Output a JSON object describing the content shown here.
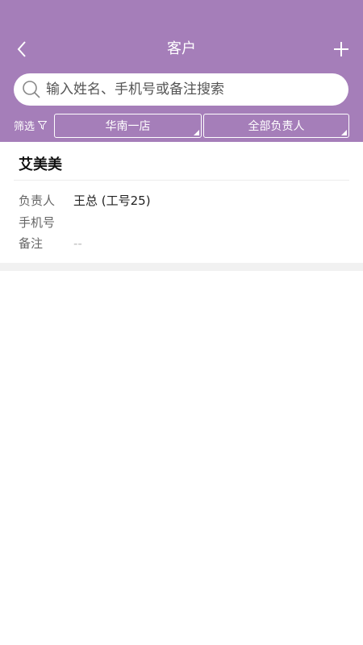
{
  "header": {
    "title": "客户",
    "back_icon": "chevron-left-icon",
    "add_icon": "plus-icon",
    "background_color": "#a57eb9"
  },
  "search": {
    "placeholder": "输入姓名、手机号或备注搜索",
    "value": ""
  },
  "filters": {
    "label": "筛选",
    "store": "华南一店",
    "owner": "全部负责人"
  },
  "customer": {
    "name": "艾美美",
    "fields": [
      {
        "label": "负责人",
        "value": "王总 (工号25)"
      },
      {
        "label": "手机号",
        "value": ""
      },
      {
        "label": "备注",
        "value": "--"
      }
    ]
  }
}
